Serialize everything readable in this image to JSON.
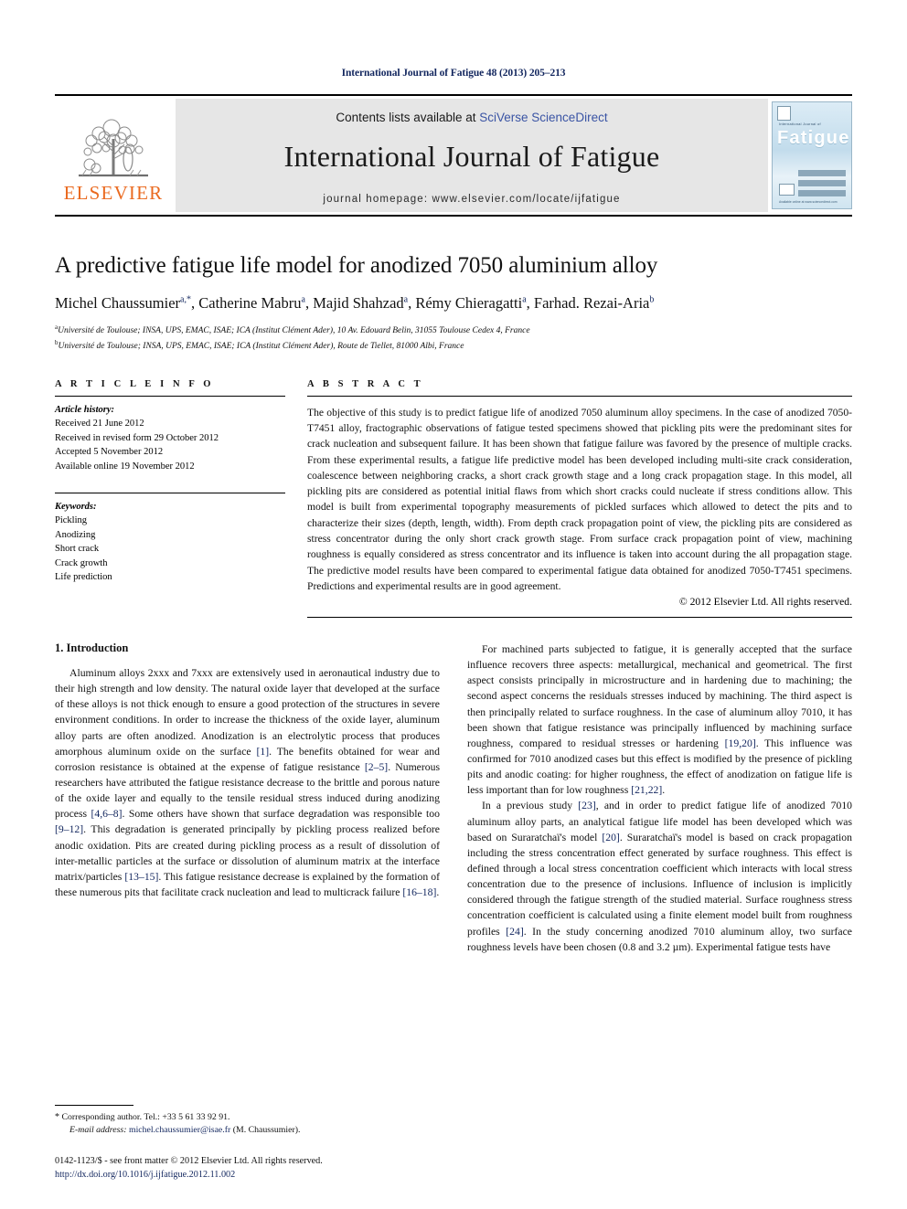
{
  "running_head": "International Journal of Fatigue 48 (2013) 205–213",
  "masthead": {
    "publisher_name": "ELSEVIER",
    "contents_prefix": "Contents lists available at ",
    "contents_link": "SciVerse ScienceDirect",
    "journal_title": "International Journal of Fatigue",
    "homepage": "journal homepage: www.elsevier.com/locate/ijfatigue",
    "cover": {
      "sub_title": "International Journal of",
      "title": "Fatigue",
      "footer_text": "Available online at www.sciencedirect.com"
    },
    "link_color": "#3a54a4",
    "band_color": "#e6e6e6",
    "elsevier_orange": "#ea6a20"
  },
  "title": "A predictive fatigue life model for anodized 7050 aluminium alloy",
  "authors": [
    {
      "name": "Michel Chaussumier",
      "marks": "a,*"
    },
    {
      "name": "Catherine Mabru",
      "marks": "a"
    },
    {
      "name": "Majid Shahzad",
      "marks": "a"
    },
    {
      "name": "Rémy Chieragatti",
      "marks": "a"
    },
    {
      "name": "Farhad. Rezai-Aria",
      "marks": "b"
    }
  ],
  "affiliations": [
    {
      "mark": "a",
      "text": "Université de Toulouse; INSA, UPS, EMAC, ISAE; ICA (Institut Clément Ader), 10 Av. Edouard Belin, 31055 Toulouse Cedex 4, France"
    },
    {
      "mark": "b",
      "text": "Université de Toulouse; INSA, UPS, EMAC, ISAE; ICA (Institut Clément Ader), Route de Tiellet, 81000 Albi, France"
    }
  ],
  "article_info": {
    "kicker": "A R T I C L E    I N F O",
    "history_label": "Article history:",
    "history": [
      "Received 21 June 2012",
      "Received in revised form 29 October 2012",
      "Accepted 5 November 2012",
      "Available online 19 November 2012"
    ],
    "keywords_label": "Keywords:",
    "keywords": [
      "Pickling",
      "Anodizing",
      "Short crack",
      "Crack growth",
      "Life prediction"
    ]
  },
  "abstract": {
    "kicker": "A B S T R A C T",
    "text": "The objective of this study is to predict fatigue life of anodized 7050 aluminum alloy specimens. In the case of anodized 7050-T7451 alloy, fractographic observations of fatigue tested specimens showed that pickling pits were the predominant sites for crack nucleation and subsequent failure. It has been shown that fatigue failure was favored by the presence of multiple cracks. From these experimental results, a fatigue life predictive model has been developed including multi-site crack consideration, coalescence between neighboring cracks, a short crack growth stage and a long crack propagation stage. In this model, all pickling pits are considered as potential initial flaws from which short cracks could nucleate if stress conditions allow. This model is built from experimental topography measurements of pickled surfaces which allowed to detect the pits and to characterize their sizes (depth, length, width). From depth crack propagation point of view, the pickling pits are considered as stress concentrator during the only short crack growth stage. From surface crack propagation point of view, machining roughness is equally considered as stress concentrator and its influence is taken into account during the all propagation stage. The predictive model results have been compared to experimental fatigue data obtained for anodized 7050-T7451 specimens. Predictions and experimental results are in good agreement.",
    "copyright": "© 2012 Elsevier Ltd. All rights reserved."
  },
  "body": {
    "section_heading": "1. Introduction",
    "left_paragraphs": [
      "Aluminum alloys 2xxx and 7xxx are extensively used in aeronautical industry due to their high strength and low density. The natural oxide layer that developed at the surface of these alloys is not thick enough to ensure a good protection of the structures in severe environment conditions. In order to increase the thickness of the oxide layer, aluminum alloy parts are often anodized. Anodization is an electrolytic process that produces amorphous aluminum oxide on the surface [1]. The benefits obtained for wear and corrosion resistance is obtained at the expense of fatigue resistance [2–5]. Numerous researchers have attributed the fatigue resistance decrease to the brittle and porous nature of the oxide layer and equally to the tensile residual stress induced during anodizing process [4,6–8]. Some others have shown that surface degradation was responsible too [9–12]. This degradation is generated principally by pickling process realized before anodic oxidation. Pits are created during pickling process as a result of dissolution of inter-metallic particles at the surface or dissolution of aluminum matrix at the interface matrix/particles [13–15]. This fatigue resistance decrease is explained by the formation of these numerous pits that facilitate crack nucleation and lead to multicrack failure [16–18]."
    ],
    "right_paragraphs": [
      "For machined parts subjected to fatigue, it is generally accepted that the surface influence recovers three aspects: metallurgical, mechanical and geometrical. The first aspect consists principally in microstructure and in hardening due to machining; the second aspect concerns the residuals stresses induced by machining. The third aspect is then principally related to surface roughness. In the case of aluminum alloy 7010, it has been shown that fatigue resistance was principally influenced by machining surface roughness, compared to residual stresses or hardening [19,20]. This influence was confirmed for 7010 anodized cases but this effect is modified by the presence of pickling pits and anodic coating: for higher roughness, the effect of anodization on fatigue life is less important than for low roughness [21,22].",
      "In a previous study [23], and in order to predict fatigue life of anodized 7010 aluminum alloy parts, an analytical fatigue life model has been developed which was based on Suraratchaï's model [20]. Suraratchaï's model is based on crack propagation including the stress concentration effect generated by surface roughness. This effect is defined through a local stress concentration coefficient which interacts with local stress concentration due to the presence of inclusions. Influence of inclusion is implicitly considered through the fatigue strength of the studied material. Surface roughness stress concentration coefficient is calculated using a finite element model built from roughness profiles [24]. In the study concerning anodized 7010 aluminum alloy, two surface roughness levels have been chosen (0.8 and 3.2 µm). Experimental fatigue tests have"
    ]
  },
  "footer": {
    "corresponding_mark": "*",
    "corresponding_text": "Corresponding author. Tel.: +33 5 61 33 92 91.",
    "email_label": "E-mail address:",
    "email": "michel.chaussumier@isae.fr",
    "email_suffix": "(M. Chaussumier).",
    "issn_line": "0142-1123/$ - see front matter © 2012 Elsevier Ltd. All rights reserved.",
    "doi_line": "http://dx.doi.org/10.1016/j.ijfatigue.2012.11.002"
  }
}
